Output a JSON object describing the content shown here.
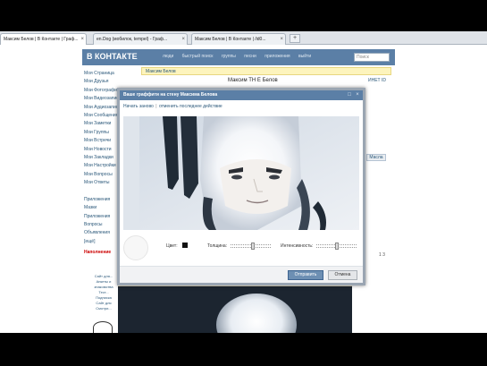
{
  "browser": {
    "tabs": [
      {
        "label": "Максим Белов | В Контакте | Граф..."
      },
      {
        "label": "en.Dog (мобилок, tempel) - Граф..."
      },
      {
        "label": "Максим Белов | В Контакте | /id0..."
      }
    ],
    "new_tab": "+"
  },
  "vk": {
    "logo": "В КОНТАКТЕ",
    "nav": [
      "люди",
      "быстрый поиск",
      "группы",
      "песни",
      "приложения",
      "выйти"
    ],
    "search_placeholder": "Поиск",
    "profile_bar": "Максим Белов",
    "profile_name": "Максим TH E Белов",
    "profile_id": "ИНЕТ ID",
    "right_button": "Масла",
    "right_indicator": "1 3",
    "left_menu": [
      "Моя Страница",
      "Мои Друзья",
      "Мои Фотографии",
      "Мои Видеозаписи",
      "Мои Аудиозаписи",
      "Мои Сообщения",
      "Мои Заметки",
      "Мои Группы",
      "Мои Встречи",
      "Мои Новости",
      "Мои Закладки",
      "Мои Настройки",
      "Мои Вопросы",
      "Мои Ответы"
    ],
    "left_menu_extra": [
      "Приложения",
      "Мазки",
      "Приложения",
      "Вопросы",
      "Объявления",
      "[ещё]"
    ],
    "ad_title": "Наполнение",
    "ad_lines": [
      "Сайт для...",
      "Анкеты и",
      "знакомства",
      "Тест...",
      "Подписка",
      "Сайт для",
      "Смотри..."
    ]
  },
  "dialog": {
    "title": "Ваше граффити на стену Максима Белова",
    "subtitle_cancel": "отменить",
    "subtitle_separator": "|",
    "subtitle_cancel_all": "отменить последнее действие",
    "subtitle_prefix": "Начать заново",
    "tools": {
      "color_label": "Цвет:",
      "thickness_label": "Толщина:",
      "opacity_label": "Интенсивность:",
      "thickness_value": 0.55,
      "opacity_value": 0.5
    },
    "send_button": "Отправить",
    "cancel_button": "Отмена"
  },
  "colors": {
    "vk_blue": "#5b7fa6",
    "link": "#2b587a",
    "swatch": "#111111"
  }
}
